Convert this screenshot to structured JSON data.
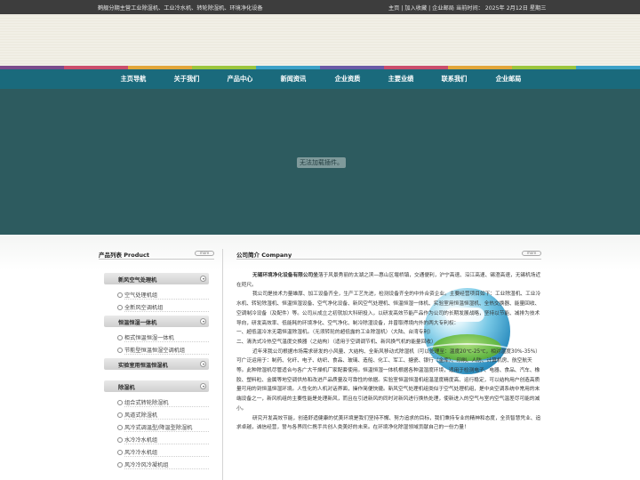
{
  "topbar": {
    "tagline": "鹤舰分期主营工业除湿机、工业冷水机、转轮除湿机、环境净化设备",
    "links": "主页 | 加入收藏 | 企业邮局",
    "datetime": "当前时间：  2025年 2月12日 星期三"
  },
  "stripe_colors": [
    "#7a4b8c",
    "#cb4d6c",
    "#e2a63a",
    "#9bc53d",
    "#3ba0c7",
    "#6a5aa6",
    "#cb4d6c",
    "#e2a63a",
    "#9bc53d",
    "#3ba0c7"
  ],
  "nav": {
    "items": [
      "主页导航",
      "关于我们",
      "产品中心",
      "新闻资讯",
      "企业资质",
      "主要业绩",
      "联系我们",
      "企业邮局"
    ]
  },
  "hero": {
    "placeholder": "无法加载插件。"
  },
  "products": {
    "title": "产品列表 Product",
    "more": "more",
    "categories": [
      {
        "label": "新风空气处理机",
        "items": [
          "空气处理机组",
          "全新风空调机组"
        ]
      },
      {
        "label": "恒温恒湿一体机",
        "items": [
          "柜式恒温恒湿一体机",
          "节能型恒温恒湿空调机组"
        ]
      },
      {
        "label": "实验室用恒温恒湿机",
        "items": []
      },
      {
        "label": "除湿机",
        "items": [
          "组合式转轮除湿机",
          "风道式除湿机",
          "风冷式调温型/降温型除湿机",
          "水冷冷水机组",
          "风冷冷水机组",
          "风冷冷风冷凝机组"
        ]
      }
    ]
  },
  "company": {
    "title": "公司简介 Company",
    "more": "more",
    "name": "无锡环境净化设备有限公司坐",
    "p1_rest": "落于风景秀丽的太湖之滨—惠山区堰桥镇，交通便利，沪宁高速、沿江高速、锡澄高速，无锡机场近在咫尺。",
    "p2": "我公司是技术力量雄厚、加工设备齐全，生产工艺先进，检测设备齐全的中外合资企业。主要经营项目如下：工业除湿机、工业冷水机、转轮除湿机、恒温恒湿设备、空气净化设备、新风空气处理机、恒温恒湿一体机、实验室用恒温恒湿机、全热交换器、能量回收、空调制冷设备（及配件）等。公司从成立之初就加大科研投入，以研发高效节能产品作为公司的长期发展战略，坚持以节能、减排为技术导向，研发高效率、低能耗的环境净化、空气净化、制冷除湿设备，并曾取得境内外的两大专利权：",
    "p3": "一、超低温冷冻无霜恒温除湿机。（无须转轮的超低露的工业除湿机）（大陆、台湾专利）",
    "p4": "二、清洗式冷热空气温度交换器（之结构）（适用于空调调节机、新风换气机的能量回收）",
    "p5": "近年来我公司根据市场需求研发的小风量、大结构、全新风移动式除湿机（可以处理至：温度20℃-25℃，相对湿度30%-35%）可广泛运用于：制药、化纤、电子、纺织、食品、玻璃、造船、化工、军工、搪瓷、银行（金库）、印刷、人防、计算机房、航空航天等。此种除湿机尽管适合与各广大干燥机厂家配套使用。恒温恒湿一体机根据各种温湿度环境，适用于检测电子、电器、食品、汽车、橡胶、塑料粒、金属等地空调供热和改进产品质量及可靠性的依据。实验室恒温恒湿机组温湿度精度高、运行稳定，可以结构用户创造高质量可用的到恒温恒湿环境。人性化的人机对话界面，操作简便快捷。新风空气处理机组类似于空气处理机组，是中央空调系统中常用的末端设备之一，新风机组的主要性能是处理新风，而且在引进新风的同时对新风进行换热处理，使新进入的空气与室内空气温差尽可能的减小。",
    "p6": "研究开发高效节能，创造舒适健康的优美环境是我们坚持不懈、努力追求的目标，我们秉持专业的精神和态度，全员智慧凭业、追求卓越，诚信经营，誓与各界同仁携手共创人类美好的未来。在环境净化除湿领域贡献自己的一份力量！"
  }
}
